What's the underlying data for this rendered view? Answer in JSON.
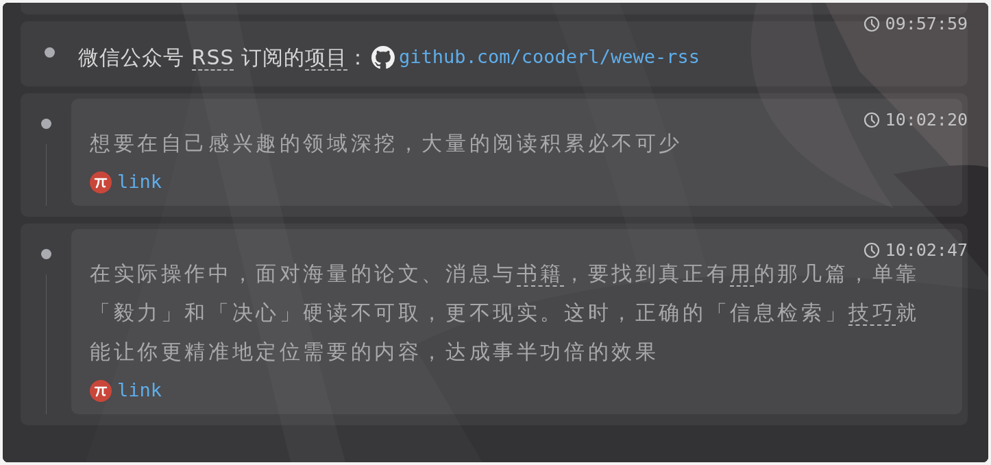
{
  "entries": [
    {
      "kind": "inline",
      "time": "09:57:59",
      "segments": [
        {
          "text": "微信公众号 ",
          "annotated": false
        },
        {
          "text": "RSS",
          "annotated": true
        },
        {
          "text": " 订阅的",
          "annotated": false
        },
        {
          "text": "项目",
          "annotated": true
        },
        {
          "text": "：",
          "annotated": false
        }
      ],
      "link": "github.com/cooderl/wewe-rss"
    },
    {
      "kind": "quote",
      "time": "10:02:20",
      "segments": [
        {
          "text": "想要在自己感兴趣的领域深挖，大量的阅读积累必不可少",
          "annotated": false
        }
      ],
      "link": "link"
    },
    {
      "kind": "quote",
      "time": "10:02:47",
      "segments": [
        {
          "text": "在实际操作中，面对海量的论文、消息与",
          "annotated": false
        },
        {
          "text": "书籍",
          "annotated": true
        },
        {
          "text": "，要找到真正有",
          "annotated": false
        },
        {
          "text": "用",
          "annotated": true
        },
        {
          "text": "的那几篇，单靠「毅力」和「决心」硬读不可取，更不现实。这时，正确的「信息检索」",
          "annotated": false
        },
        {
          "text": "技巧",
          "annotated": true
        },
        {
          "text": "就能让你更精准地定位需要的内容，达成事半功倍的效果",
          "annotated": false
        }
      ],
      "link": "link"
    }
  ]
}
